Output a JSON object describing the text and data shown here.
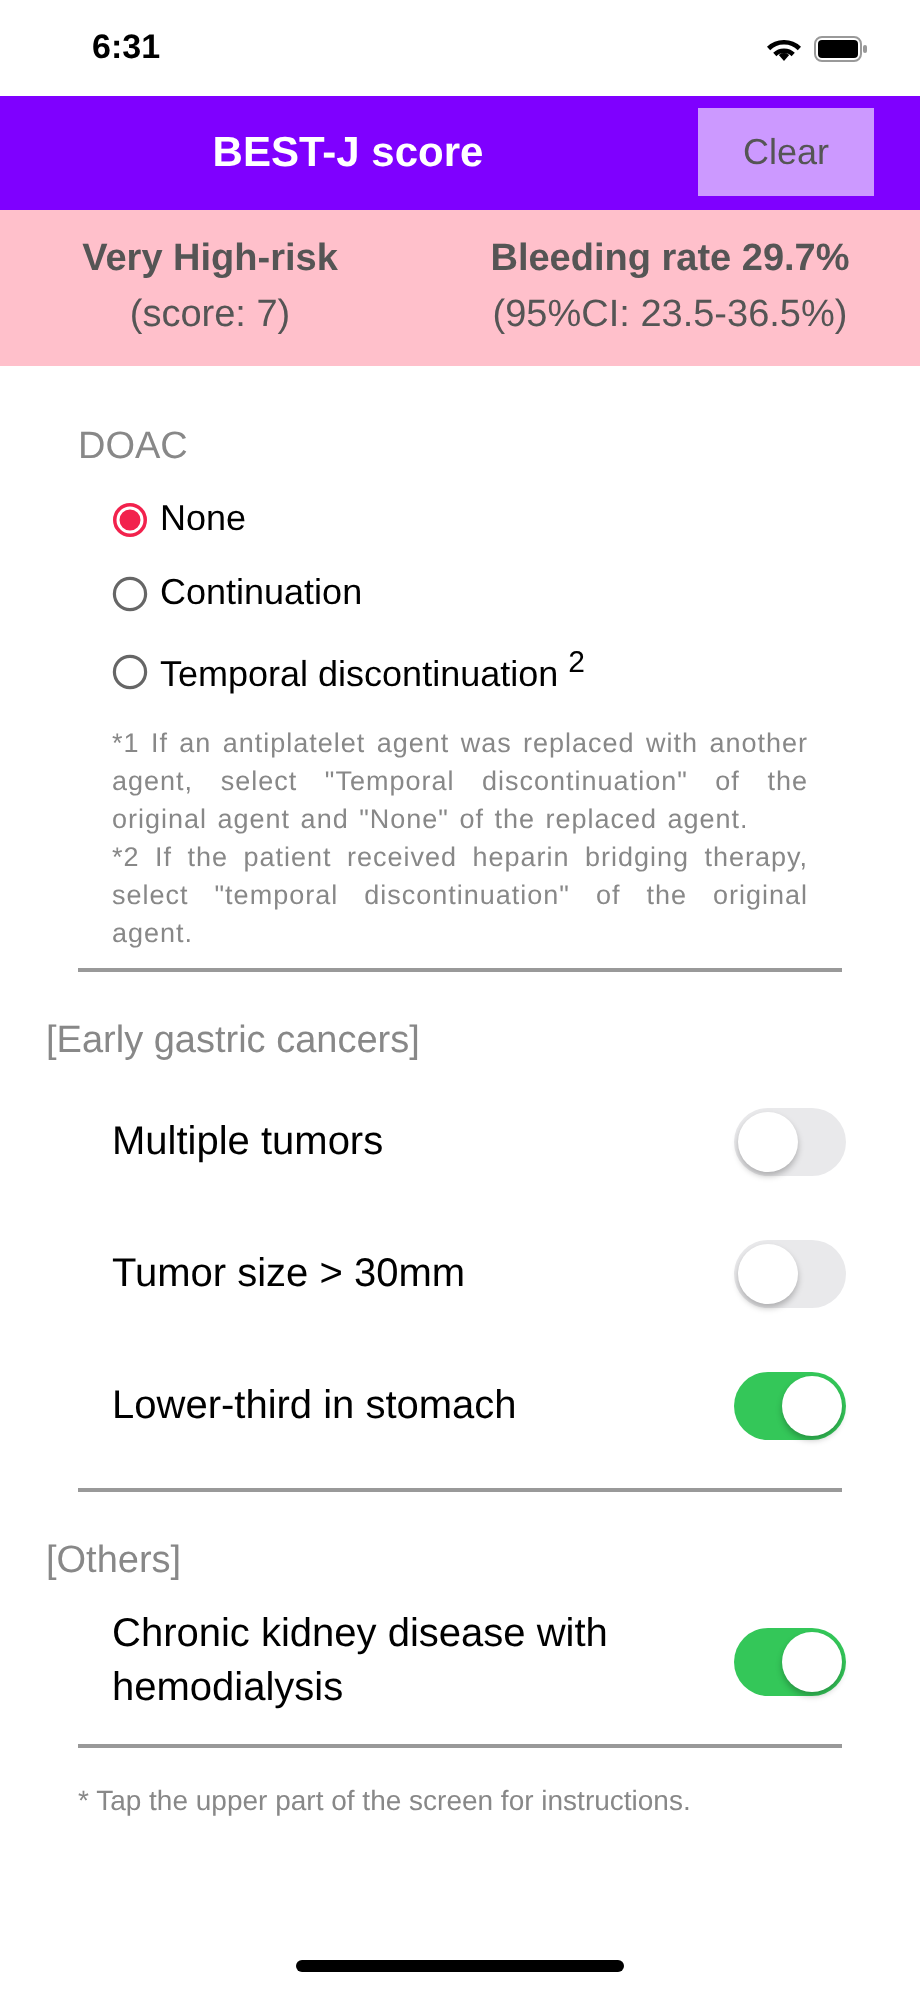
{
  "status_bar": {
    "time": "6:31"
  },
  "header": {
    "title": "BEST-J score",
    "clear_button": "Clear"
  },
  "result": {
    "risk": "Very High-risk",
    "score": "(score: 7)",
    "rate": "Bleeding rate 29.7%",
    "ci": "(95%CI: 23.5-36.5%)"
  },
  "doac": {
    "label": "DOAC",
    "options": [
      {
        "label": "None",
        "selected": true
      },
      {
        "label": "Continuation",
        "selected": false
      },
      {
        "label": "Temporal discontinuation $^{2}$",
        "selected": false
      }
    ],
    "footnotes": [
      "*1  If an antiplatelet agent was replaced with another agent, select \"Temporal discontinuation\" of the original agent and \"None\" of the replaced agent.",
      "*2  If the patient received heparin bridging therapy, select \"temporal discontinuation\" of the original agent."
    ]
  },
  "sections": [
    {
      "title": "[Early gastric cancers]",
      "items": [
        {
          "label": "Multiple tumors",
          "on": false
        },
        {
          "label": "Tumor size > 30mm",
          "on": false
        },
        {
          "label": "Lower-third in stomach",
          "on": true
        }
      ]
    },
    {
      "title": "[Others]",
      "items": [
        {
          "label": "Chronic kidney disease with hemodialysis",
          "on": true
        }
      ]
    }
  ],
  "note": "* Tap the upper part of the screen for instructions."
}
